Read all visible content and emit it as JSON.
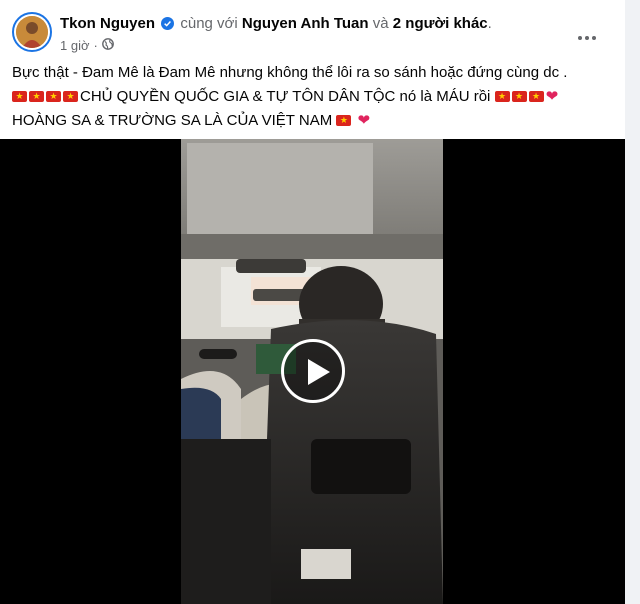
{
  "post": {
    "author": "Tkon Nguyen",
    "with_text": "cùng với",
    "tagged_friend": "Nguyen Anh Tuan",
    "and_text": "và",
    "others": "2 người khác",
    "period": ".",
    "time": "1 giờ",
    "dot": "·",
    "privacy_icon": "globe-icon",
    "more_icon": "more-options-icon"
  },
  "content": {
    "line1": "Bực thật - Đam Mê là Đam Mê nhưng không thể lôi ra so sánh hoặc đứng cùng dc .",
    "line2_text": "CHỦ QUYỀN QUỐC GIA & TỰ TÔN DÂN TỘC nó là MÁU rồi",
    "line3_text": "HOÀNG SA & TRƯỜNG SA LÀ CỦA VIỆT NAM",
    "emoji": {
      "flag": "vietnam-flag",
      "heart": "❤"
    }
  },
  "video": {
    "play_icon": "play-icon"
  },
  "colors": {
    "verified": "#1b74e4",
    "flag_red": "#da251d",
    "flag_star": "#ffcd00",
    "heart": "#e0245e"
  }
}
